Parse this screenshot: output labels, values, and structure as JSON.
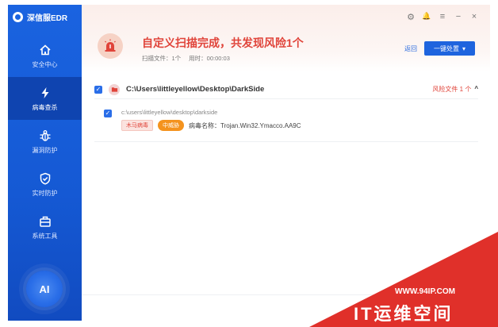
{
  "app": {
    "brand": "深信服EDR"
  },
  "sidebar": {
    "items": [
      {
        "label": "安全中心",
        "icon": "home-icon"
      },
      {
        "label": "病毒查杀",
        "icon": "lightning-icon"
      },
      {
        "label": "漏洞防护",
        "icon": "bug-icon"
      },
      {
        "label": "实时防护",
        "icon": "shield-check-icon"
      },
      {
        "label": "系统工具",
        "icon": "toolbox-icon"
      }
    ],
    "active_index": 1,
    "ai_label": "AI"
  },
  "window_controls": {
    "settings": "⚙",
    "notification": "🔔",
    "menu": "≡",
    "minimize": "−",
    "close": "×"
  },
  "header": {
    "title": "自定义扫描完成，共发现风险1个",
    "scan_files_label": "扫描文件：1个",
    "elapsed_label": "用时：00:00:03",
    "back_link": "返回",
    "action_button": "一键处置",
    "action_caret": "▾"
  },
  "results": {
    "group_path": "C:\\Users\\littleyellow\\Desktop\\DarkSide",
    "risk_label": "风险文件 1 个",
    "collapse_icon": "^",
    "items": [
      {
        "path": "c:\\users\\littleyellow\\desktop\\darkside",
        "type_tag": "木马病毒",
        "level_tag": "中威胁",
        "virus_name": "病毒名称：Trojan.Win32.Ymacco.AA9C"
      }
    ]
  },
  "watermark": {
    "url": "WWW.94IP.COM",
    "text": "IT运维空间"
  },
  "colors": {
    "sidebar": "#1a63e0",
    "alert_red": "#e0443a",
    "accent_blue": "#1e64de",
    "level_orange": "#f4931e",
    "watermark_red": "#e0302a"
  }
}
